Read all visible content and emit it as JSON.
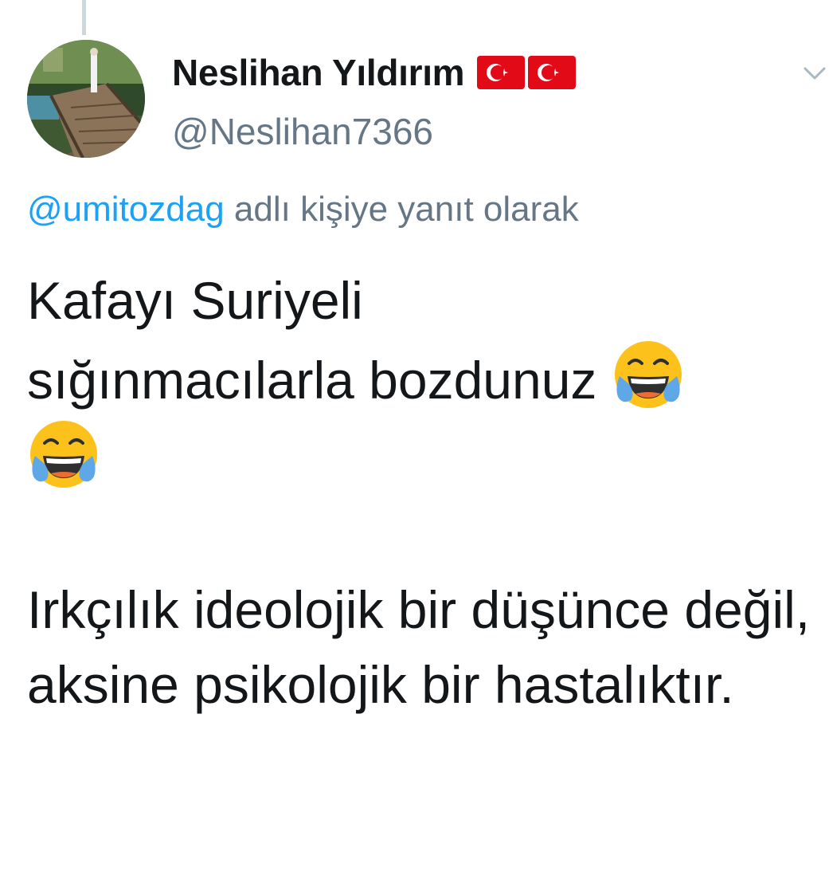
{
  "tweet": {
    "author": {
      "display_name": "Neslihan Yıldırım",
      "handle": "@Neslihan7366",
      "flags": [
        "turkey-flag",
        "turkey-flag"
      ]
    },
    "reply_context": {
      "mention": "@umitozdag",
      "suffix": " adlı kişiye yanıt olarak"
    },
    "text": {
      "line1": "Kafayı Suriyeli",
      "line2": "sığınmacılarla bozdunuz ",
      "paragraph2": "Irkçılık ideolojik bir düşünce değil, aksine psikolojik bir hastalıktır.",
      "emoji": "face-with-tears-of-joy-icon"
    }
  },
  "colors": {
    "text_primary": "#14171a",
    "text_secondary": "#657786",
    "link": "#1da1f2",
    "flag_red": "#e30a17"
  }
}
